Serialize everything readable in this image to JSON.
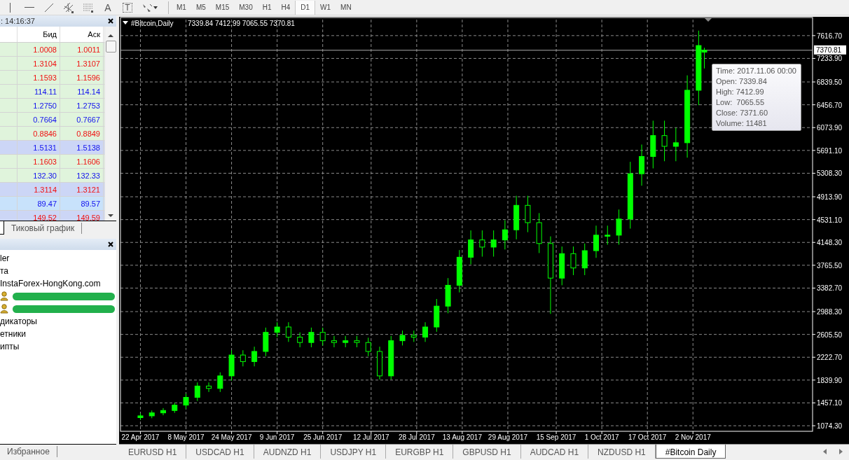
{
  "toolbar": {
    "tools": [
      {
        "kind": "vline"
      },
      {
        "kind": "hline"
      },
      {
        "kind": "trendline"
      },
      {
        "kind": "channel"
      },
      {
        "kind": "fibo"
      },
      {
        "kind": "text",
        "label": "A"
      },
      {
        "kind": "label",
        "label": "T"
      },
      {
        "kind": "arrows"
      }
    ],
    "timeframes": [
      {
        "label": "M1",
        "selected": false
      },
      {
        "label": "M5",
        "selected": false
      },
      {
        "label": "M15",
        "selected": false
      },
      {
        "label": "M30",
        "selected": false
      },
      {
        "label": "H1",
        "selected": false
      },
      {
        "label": "H4",
        "selected": false
      },
      {
        "label": "D1",
        "selected": true
      },
      {
        "label": "W1",
        "selected": false
      },
      {
        "label": "MN",
        "selected": false
      }
    ]
  },
  "market_watch": {
    "time": ": 14:16:37",
    "columns": [
      "Бид",
      "Аск"
    ],
    "rows": [
      {
        "bid": "1.0008",
        "ask": "1.0011",
        "rising": false,
        "color": "#e0f4dc"
      },
      {
        "bid": "1.3104",
        "ask": "1.3107",
        "rising": false,
        "color": "#e0f4dc"
      },
      {
        "bid": "1.1593",
        "ask": "1.1596",
        "rising": false,
        "color": "#e0f4dc"
      },
      {
        "bid": "114.11",
        "ask": "114.14",
        "rising": true,
        "color": "#e0f4dc"
      },
      {
        "bid": "1.2750",
        "ask": "1.2753",
        "rising": true,
        "color": "#e0f4dc"
      },
      {
        "bid": "0.7664",
        "ask": "0.7667",
        "rising": true,
        "color": "#e0f4dc"
      },
      {
        "bid": "0.8846",
        "ask": "0.8849",
        "rising": false,
        "color": "#e0f4dc"
      },
      {
        "bid": "1.5131",
        "ask": "1.5138",
        "rising": true,
        "color": "#ccd6f6"
      },
      {
        "bid": "1.1603",
        "ask": "1.1606",
        "rising": false,
        "color": "#e0f4dc"
      },
      {
        "bid": "132.30",
        "ask": "132.33",
        "rising": true,
        "color": "#e0f4dc"
      },
      {
        "bid": "1.3114",
        "ask": "1.3121",
        "rising": false,
        "color": "#ccd6f6"
      },
      {
        "bid": "89.47",
        "ask": "89.57",
        "rising": true,
        "color": "#c8e2fb"
      },
      {
        "bid": "149.52",
        "ask": "149.59",
        "rising": false,
        "color": "#ccd6f6"
      }
    ],
    "tabs": [
      {
        "label": "Тиковый график",
        "selected": false
      }
    ]
  },
  "navigator": {
    "items": [
      {
        "kind": "folder",
        "label": "ler"
      },
      {
        "kind": "folder",
        "label": "та"
      },
      {
        "kind": "server",
        "label": "InstaForex-HongKong.com"
      },
      {
        "kind": "account"
      },
      {
        "kind": "account"
      },
      {
        "kind": "folder",
        "label": "дикаторы"
      },
      {
        "kind": "folder",
        "label": "етники"
      },
      {
        "kind": "folder",
        "label": "ипты"
      }
    ],
    "tabs": [
      {
        "label": "Избранное",
        "selected": false
      }
    ]
  },
  "chart": {
    "symbol": "#Bitcoin,Daily",
    "ohlc": "7339.84 7412.99 7065.55 7370.81",
    "tooltip": [
      "Time: 2017.11.06 00:00",
      "Open: 7339.84",
      "High: 7412.99",
      "Low:  7065.55",
      "Close: 7371.60",
      "Volume: 11481"
    ],
    "chart_data": {
      "type": "candlestick",
      "grid": true,
      "x": [
        "2017-04-22",
        "2017-04-26",
        "2017-04-30",
        "2017-05-04",
        "2017-05-08",
        "2017-05-12",
        "2017-05-16",
        "2017-05-20",
        "2017-05-24",
        "2017-05-28",
        "2017-06-01",
        "2017-06-05",
        "2017-06-09",
        "2017-06-13",
        "2017-06-17",
        "2017-06-21",
        "2017-06-25",
        "2017-06-29",
        "2017-07-03",
        "2017-07-07",
        "2017-07-11",
        "2017-07-15",
        "2017-07-19",
        "2017-07-23",
        "2017-07-27",
        "2017-07-31",
        "2017-08-04",
        "2017-08-08",
        "2017-08-12",
        "2017-08-16",
        "2017-08-20",
        "2017-08-24",
        "2017-08-28",
        "2017-09-01",
        "2017-09-05",
        "2017-09-09",
        "2017-09-13",
        "2017-09-17",
        "2017-09-21",
        "2017-09-25",
        "2017-09-29",
        "2017-10-03",
        "2017-10-07",
        "2017-10-11",
        "2017-10-15",
        "2017-10-19",
        "2017-10-23",
        "2017-10-27",
        "2017-10-31",
        "2017-11-04",
        "2017-11-06"
      ],
      "ohlc": [
        [
          1210,
          1280,
          1170,
          1240
        ],
        [
          1240,
          1330,
          1200,
          1290
        ],
        [
          1290,
          1370,
          1250,
          1330
        ],
        [
          1330,
          1460,
          1290,
          1420
        ],
        [
          1420,
          1610,
          1360,
          1550
        ],
        [
          1550,
          1800,
          1490,
          1740
        ],
        [
          1740,
          1800,
          1640,
          1700
        ],
        [
          1700,
          1970,
          1640,
          1910
        ],
        [
          1910,
          2340,
          1830,
          2260
        ],
        [
          2260,
          2340,
          2070,
          2150
        ],
        [
          2150,
          2400,
          2070,
          2320
        ],
        [
          2320,
          2720,
          2240,
          2640
        ],
        [
          2640,
          2810,
          2560,
          2730
        ],
        [
          2730,
          2810,
          2480,
          2560
        ],
        [
          2560,
          2640,
          2390,
          2470
        ],
        [
          2470,
          2720,
          2390,
          2640
        ],
        [
          2640,
          2720,
          2420,
          2500
        ],
        [
          2500,
          2580,
          2390,
          2470
        ],
        [
          2470,
          2580,
          2390,
          2500
        ],
        [
          2500,
          2580,
          2390,
          2470
        ],
        [
          2470,
          2550,
          2240,
          2320
        ],
        [
          2320,
          2400,
          1850,
          1910
        ],
        [
          1910,
          2580,
          1850,
          2500
        ],
        [
          2500,
          2670,
          2420,
          2590
        ],
        [
          2590,
          2670,
          2480,
          2560
        ],
        [
          2560,
          2810,
          2480,
          2730
        ],
        [
          2730,
          3200,
          2650,
          3080
        ],
        [
          3080,
          3550,
          2960,
          3430
        ],
        [
          3430,
          4020,
          3310,
          3900
        ],
        [
          3900,
          4350,
          3780,
          4190
        ],
        [
          4190,
          4350,
          3910,
          4070
        ],
        [
          4070,
          4350,
          3910,
          4190
        ],
        [
          4190,
          4520,
          4030,
          4360
        ],
        [
          4360,
          4930,
          4200,
          4770
        ],
        [
          4770,
          4930,
          4320,
          4480
        ],
        [
          4480,
          4640,
          3970,
          4130
        ],
        [
          4130,
          4250,
          2950,
          3550
        ],
        [
          3550,
          4080,
          3430,
          3960
        ],
        [
          3960,
          4080,
          3600,
          3720
        ],
        [
          3720,
          4130,
          3600,
          4010
        ],
        [
          4010,
          4430,
          3890,
          4270
        ],
        [
          4270,
          4430,
          4110,
          4270
        ],
        [
          4270,
          4700,
          4110,
          4540
        ],
        [
          4540,
          5500,
          4380,
          5300
        ],
        [
          5300,
          5790,
          5100,
          5590
        ],
        [
          5590,
          6190,
          5390,
          5940
        ],
        [
          5940,
          6190,
          5510,
          5760
        ],
        [
          5760,
          6070,
          5510,
          5820
        ],
        [
          5820,
          6950,
          5570,
          6700
        ],
        [
          6700,
          7700,
          6450,
          7450
        ],
        [
          7339.84,
          7412.99,
          7065.55,
          7371.6
        ]
      ],
      "ref_lines": [
        {
          "axis": "y",
          "value": 7370.81,
          "label": "7370.81"
        }
      ],
      "xlim": [
        "2017-04-15",
        "2017-12-14"
      ],
      "ylim": [
        981,
        7885
      ],
      "xticks": [
        {
          "value": "2017-04-22",
          "label": "22 Apr 2017"
        },
        {
          "value": "2017-05-08",
          "label": "8 May 2017"
        },
        {
          "value": "2017-05-24",
          "label": "24 May 2017"
        },
        {
          "value": "2017-06-09",
          "label": "9 Jun 2017"
        },
        {
          "value": "2017-06-25",
          "label": "25 Jun 2017"
        },
        {
          "value": "2017-07-12",
          "label": "12 Jul 2017"
        },
        {
          "value": "2017-07-28",
          "label": "28 Jul 2017"
        },
        {
          "value": "2017-08-13",
          "label": "13 Aug 2017"
        },
        {
          "value": "2017-08-29",
          "label": "29 Aug 2017"
        },
        {
          "value": "2017-09-15",
          "label": "15 Sep 2017"
        },
        {
          "value": "2017-10-01",
          "label": "1 Oct 2017"
        },
        {
          "value": "2017-10-17",
          "label": "17 Oct 2017"
        },
        {
          "value": "2017-11-02",
          "label": "2 Nov 2017"
        }
      ],
      "yticks": [
        {
          "value": 7616.7,
          "label": "7616.70"
        },
        {
          "value": 7233.9,
          "label": "7233.90"
        },
        {
          "value": 6839.5,
          "label": "6839.50"
        },
        {
          "value": 6456.7,
          "label": "6456.70"
        },
        {
          "value": 6073.9,
          "label": "6073.90"
        },
        {
          "value": 5691.1,
          "label": "5691.10"
        },
        {
          "value": 5308.3,
          "label": "5308.30"
        },
        {
          "value": 4913.9,
          "label": "4913.90"
        },
        {
          "value": 4531.1,
          "label": "4531.10"
        },
        {
          "value": 4148.3,
          "label": "4148.30"
        },
        {
          "value": 3765.5,
          "label": "3765.50"
        },
        {
          "value": 3382.7,
          "label": "3382.70"
        },
        {
          "value": 2988.3,
          "label": "2988.30"
        },
        {
          "value": 2605.5,
          "label": "2605.50"
        },
        {
          "value": 2222.7,
          "label": "2222.70"
        },
        {
          "value": 1839.9,
          "label": "1839.90"
        },
        {
          "value": 1457.1,
          "label": "1457.10"
        },
        {
          "value": 1074.3,
          "label": "1074.30"
        }
      ]
    }
  },
  "chart_tabs": [
    {
      "label": "EURUSD H1",
      "selected": false
    },
    {
      "label": "USDCAD H1",
      "selected": false
    },
    {
      "label": "AUDNZD H1",
      "selected": false
    },
    {
      "label": "USDJPY H1",
      "selected": false
    },
    {
      "label": "EURGBP H1",
      "selected": false
    },
    {
      "label": "GBPUSD H1",
      "selected": false
    },
    {
      "label": "AUDCAD H1",
      "selected": false
    },
    {
      "label": "NZDUSD H1",
      "selected": false
    },
    {
      "label": "#Bitcoin Daily",
      "selected": true
    }
  ]
}
